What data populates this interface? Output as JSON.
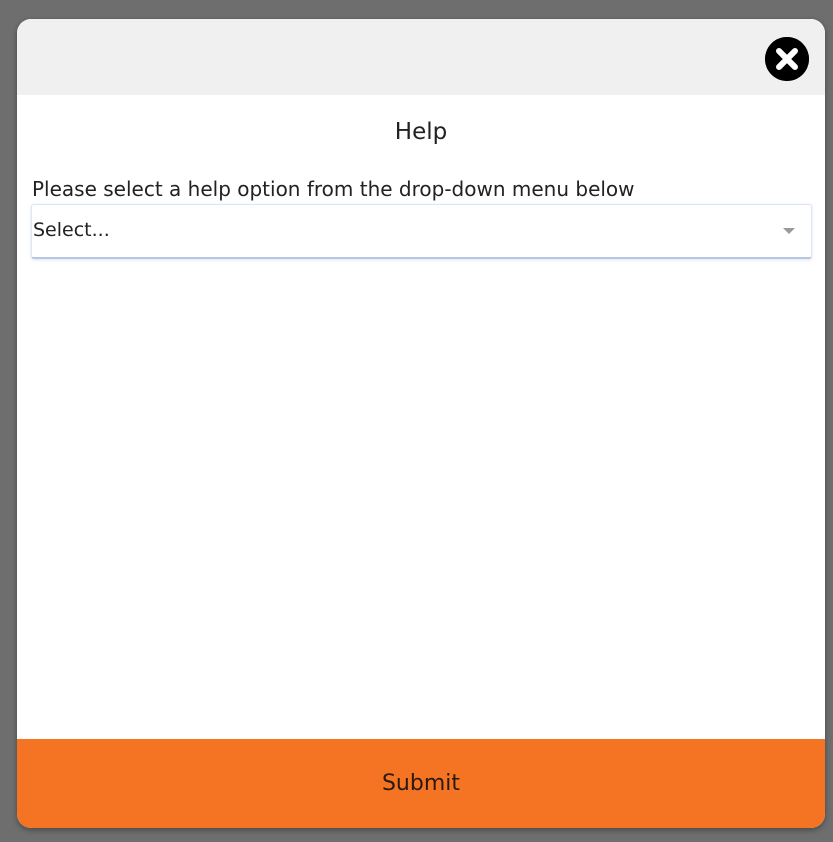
{
  "dialog": {
    "title": "Help",
    "instruction": "Please select a help option from the drop-down menu below",
    "close_icon": "close-circle-icon"
  },
  "help_select": {
    "selected_value": "Select...",
    "arrow_icon": "caret-down-icon"
  },
  "footer": {
    "submit_label": "Submit"
  },
  "colors": {
    "overlay": "#6e6e6e",
    "header_bg": "#f0f0f0",
    "submit_bg": "#f47424",
    "close_icon": "#000000"
  }
}
